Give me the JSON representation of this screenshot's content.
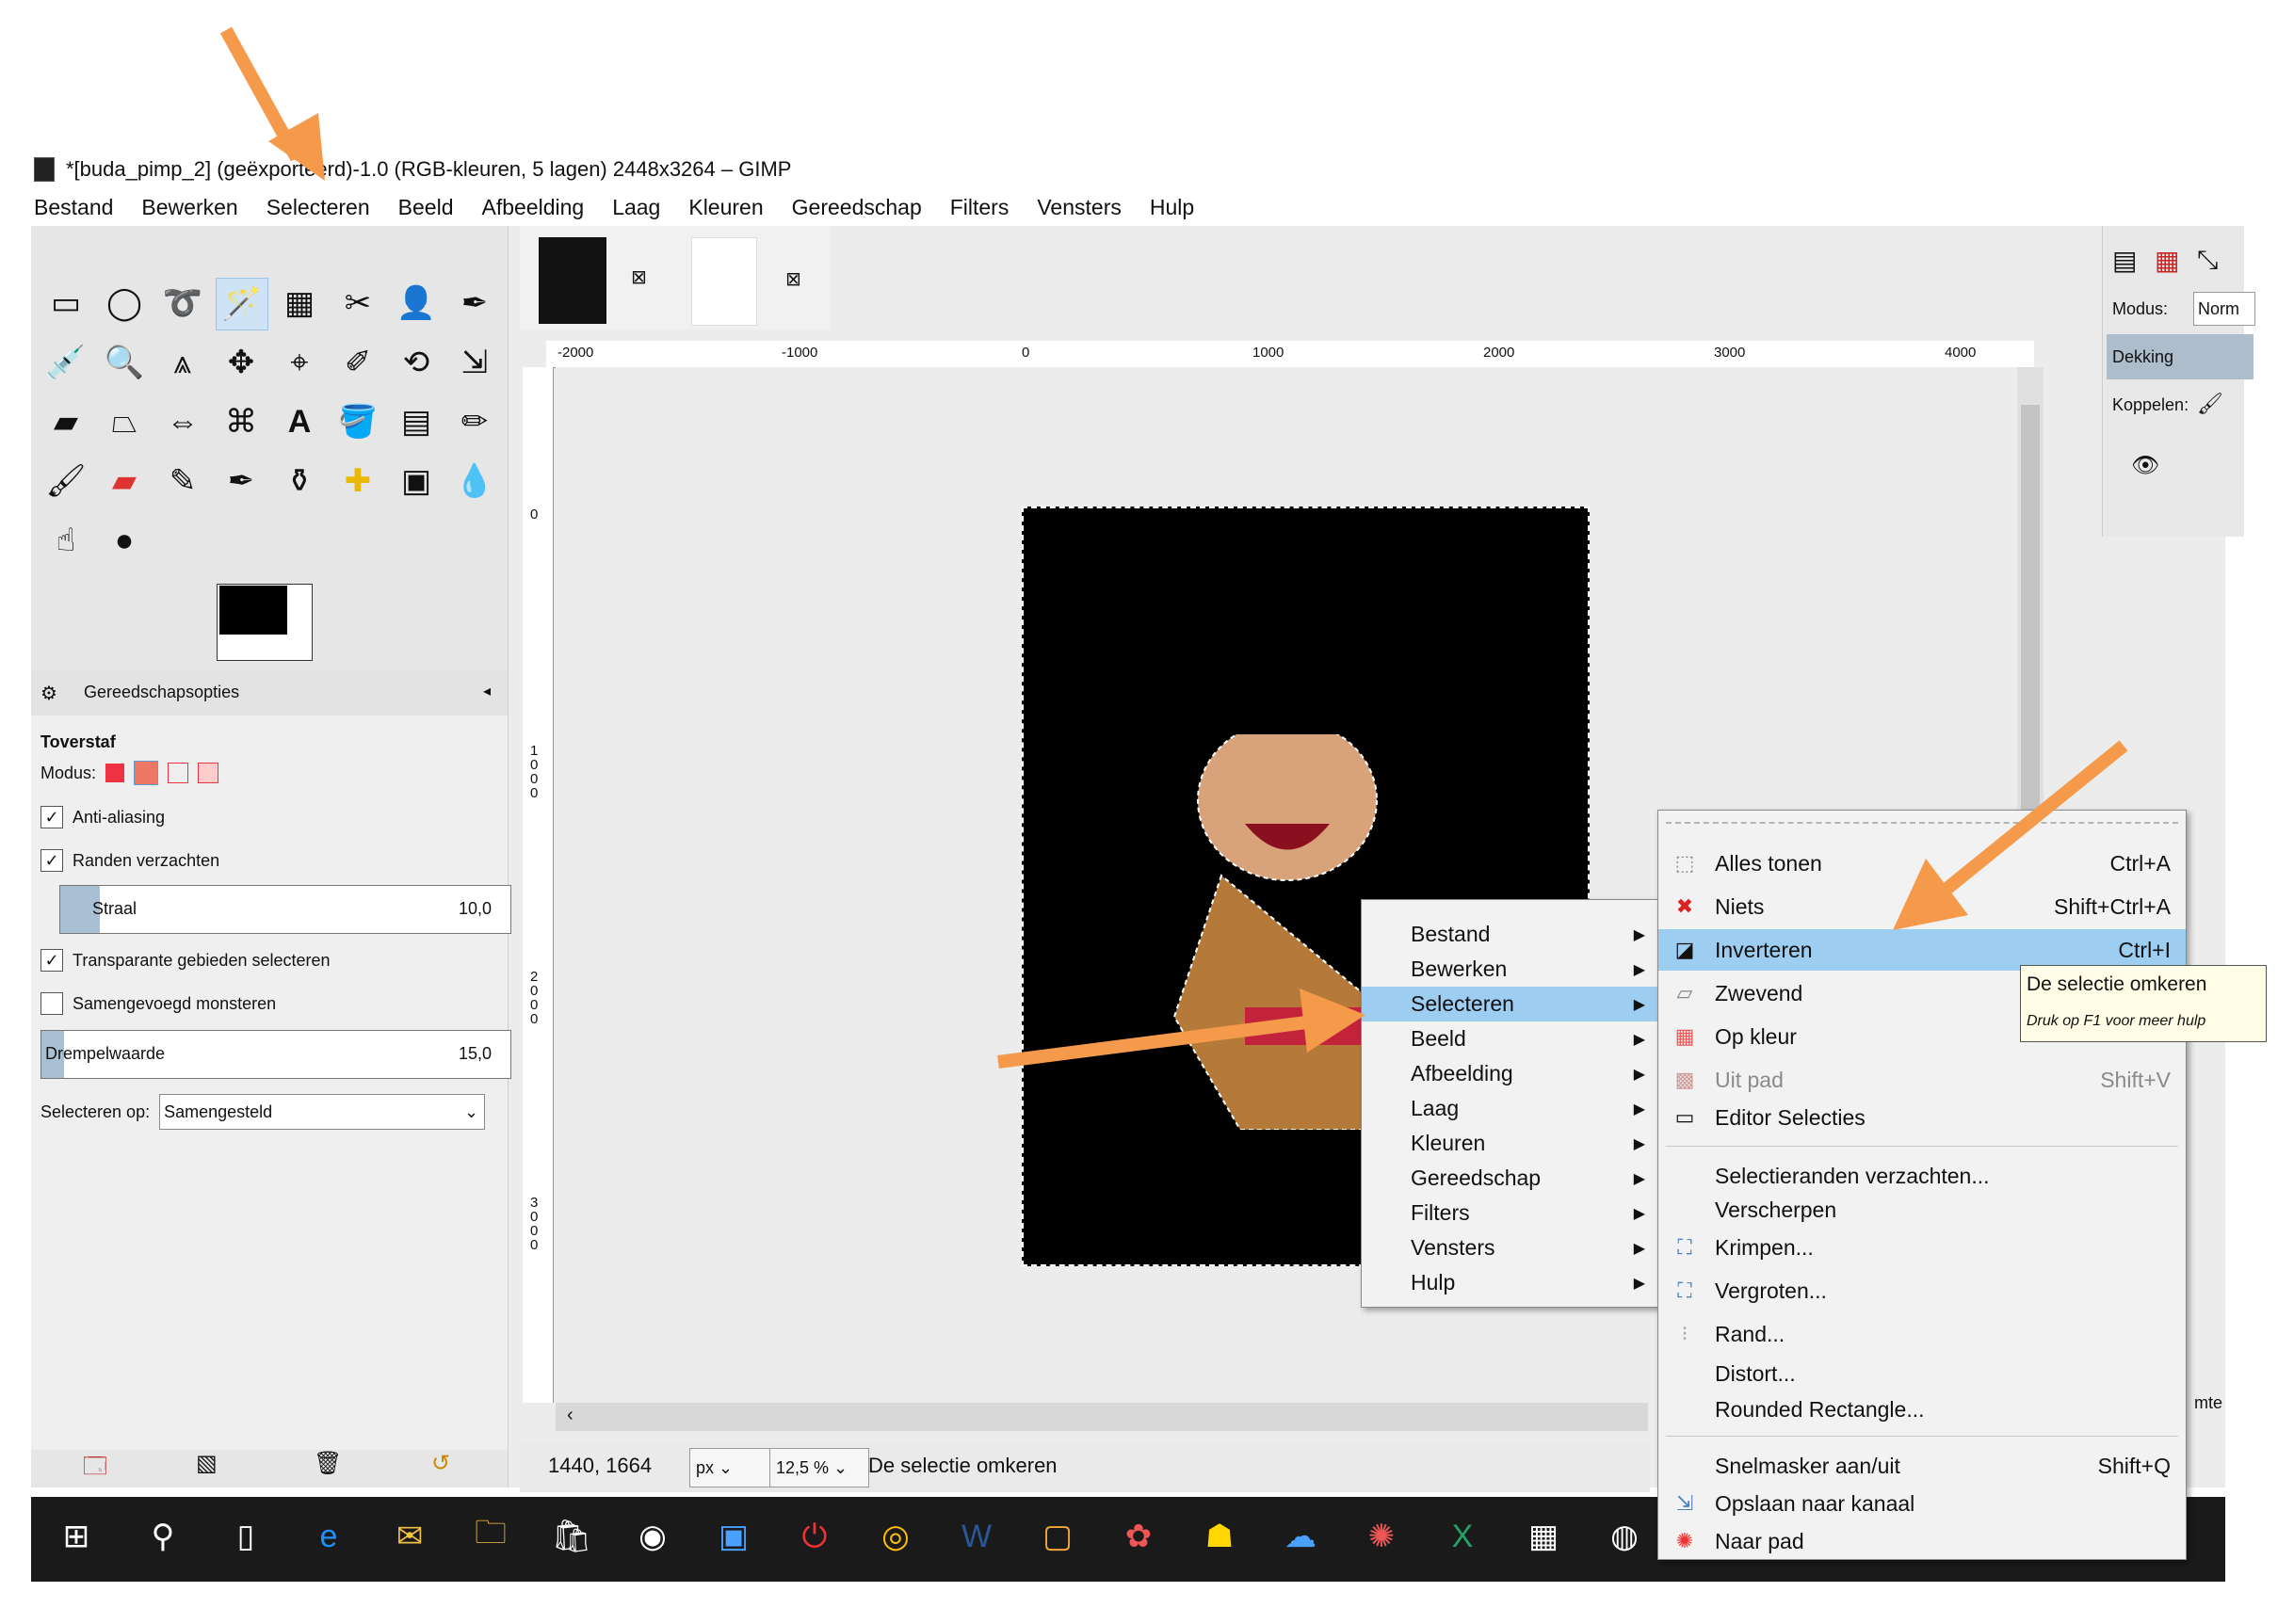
{
  "window": {
    "title": "*[buda_pimp_2] (geëxporteerd)-1.0 (RGB-kleuren, 5 lagen) 2448x3264 – GIMP"
  },
  "menubar": [
    {
      "label": "Bestand"
    },
    {
      "label": "Bewerken"
    },
    {
      "label": "Selecteren"
    },
    {
      "label": "Beeld"
    },
    {
      "label": "Afbeelding"
    },
    {
      "label": "Laag"
    },
    {
      "label": "Kleuren"
    },
    {
      "label": "Gereedschap"
    },
    {
      "label": "Filters"
    },
    {
      "label": "Vensters"
    },
    {
      "label": "Hulp"
    }
  ],
  "tool_options": {
    "header": "Gereedschapsopties",
    "tool_name": "Toverstaf",
    "mode_label": "Modus:",
    "antialiasing": "Anti-aliasing",
    "feather": "Randen verzachten",
    "radius_label": "Straal",
    "radius_value": "10,0",
    "transparent": "Transparante gebieden selecteren",
    "sample_merged": "Samengevoegd monsteren",
    "threshold_label": "Drempelwaarde",
    "threshold_value": "15,0",
    "select_by_label": "Selecteren op:",
    "select_by_value": "Samengesteld"
  },
  "ruler": {
    "top_marks": [
      "-2000",
      "-1000",
      "0",
      "1000",
      "2000",
      "3000",
      "4000"
    ],
    "left_marks": [
      "0",
      "1000",
      "2000",
      "3000"
    ]
  },
  "status": {
    "coords": "1440, 1664",
    "unit": "px",
    "zoom": "12,5 %",
    "message": "De selectie omkeren"
  },
  "dock": {
    "mode_label": "Modus:",
    "mode_value": "Norm",
    "opacity_label": "Dekking",
    "link_label": "Koppelen:",
    "extra_label": "mte"
  },
  "context_menu": [
    {
      "label": "Bestand"
    },
    {
      "label": "Bewerken"
    },
    {
      "label": "Selecteren",
      "highlight": true
    },
    {
      "label": "Beeld"
    },
    {
      "label": "Afbeelding"
    },
    {
      "label": "Laag"
    },
    {
      "label": "Kleuren"
    },
    {
      "label": "Gereedschap"
    },
    {
      "label": "Filters"
    },
    {
      "label": "Vensters"
    },
    {
      "label": "Hulp"
    }
  ],
  "select_submenu": [
    {
      "label": "Alles tonen",
      "shortcut": "Ctrl+A",
      "icon": "select-all-icon"
    },
    {
      "label": "Niets",
      "shortcut": "Shift+Ctrl+A",
      "icon": "select-none-icon"
    },
    {
      "label": "Inverteren",
      "shortcut": "Ctrl+I",
      "icon": "invert-icon",
      "highlight": true
    },
    {
      "label": "Zwevend",
      "shortcut": "",
      "icon": "float-icon"
    },
    {
      "label": "Op kleur",
      "shortcut": "",
      "icon": "by-color-icon"
    },
    {
      "label": "Uit pad",
      "shortcut": "Shift+V",
      "icon": "from-path-icon"
    },
    {
      "label": "Editor Selecties",
      "shortcut": "",
      "icon": "selection-editor-icon"
    },
    {
      "label": "Selectieranden verzachten...",
      "shortcut": "",
      "icon": ""
    },
    {
      "label": "Verscherpen",
      "shortcut": "",
      "icon": ""
    },
    {
      "label": "Krimpen...",
      "shortcut": "",
      "icon": "shrink-icon"
    },
    {
      "label": "Vergroten...",
      "shortcut": "",
      "icon": "grow-icon"
    },
    {
      "label": "Rand...",
      "shortcut": "",
      "icon": "border-icon"
    },
    {
      "label": "Distort...",
      "shortcut": "",
      "icon": ""
    },
    {
      "label": "Rounded Rectangle...",
      "shortcut": "",
      "icon": ""
    },
    {
      "label": "Snelmasker aan/uit",
      "shortcut": "Shift+Q",
      "icon": ""
    },
    {
      "label": "Opslaan naar kanaal",
      "shortcut": "",
      "icon": "save-channel-icon"
    },
    {
      "label": "Naar pad",
      "shortcut": "",
      "icon": "to-path-icon"
    }
  ],
  "tooltip": {
    "title": "De selectie omkeren",
    "hint": "Druk op F1 voor meer hulp"
  },
  "colors": {
    "highlight": "#9ecdf2",
    "annotation_arrow": "#f59a4a"
  }
}
